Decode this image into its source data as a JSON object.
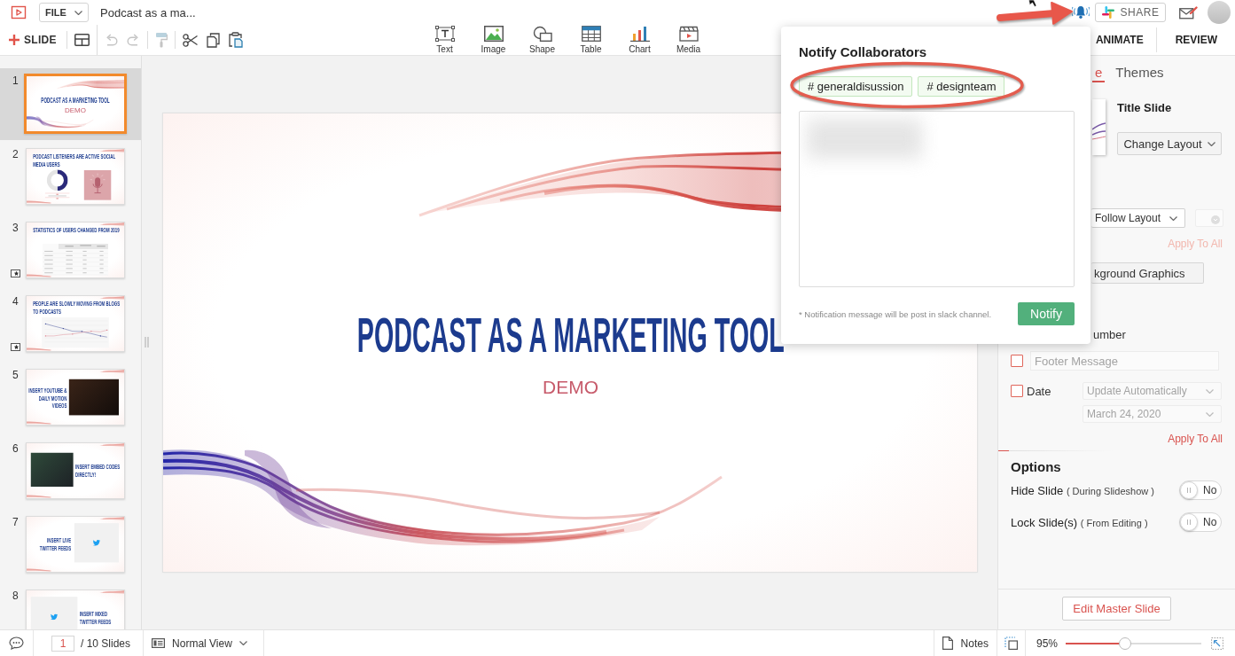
{
  "header": {
    "file_menu": "FILE",
    "document_title": "Podcast as a ma...",
    "share_button": "SHARE"
  },
  "toolbar": {
    "new_slide": "SLIDE",
    "edit_tools": [
      {
        "kind": "layout",
        "disabled": false
      },
      {
        "kind": "undo",
        "disabled": true
      },
      {
        "kind": "redo",
        "disabled": true
      },
      {
        "kind": "format_painter",
        "disabled": true
      },
      {
        "kind": "cut",
        "disabled": false
      },
      {
        "kind": "copy",
        "disabled": false
      },
      {
        "kind": "paste",
        "disabled": false
      }
    ],
    "insert_tools": [
      {
        "kind": "text",
        "label": "Text"
      },
      {
        "kind": "image",
        "label": "Image"
      },
      {
        "kind": "shape",
        "label": "Shape"
      },
      {
        "kind": "table",
        "label": "Table"
      },
      {
        "kind": "chart",
        "label": "Chart"
      },
      {
        "kind": "media",
        "label": "Media"
      }
    ],
    "menu_tabs": [
      {
        "label": "ANIMATE"
      },
      {
        "label": "REVIEW"
      }
    ]
  },
  "slides": [
    {
      "number": "1",
      "selected": true,
      "animated": false,
      "kind": "title",
      "title": "PODCAST AS A MARKETING TOOL",
      "subtitle": "DEMO"
    },
    {
      "number": "2",
      "selected": false,
      "animated": false,
      "kind": "donut_image",
      "title": "PODCAST LISTENERS ARE ACTIVE SOCIAL MEDIA USERS"
    },
    {
      "number": "3",
      "selected": false,
      "animated": true,
      "kind": "table",
      "title": "STATISTICS OF USERS CHANGED FROM 2019"
    },
    {
      "number": "4",
      "selected": false,
      "animated": true,
      "kind": "line_chart",
      "title": "PEOPLE ARE SLOWLY MOVING FROM BLOGS TO PODCASTS"
    },
    {
      "number": "5",
      "selected": false,
      "animated": false,
      "kind": "text_photo",
      "title": "INSERT YOUTUBE & DAILY MOTION VIDEOS"
    },
    {
      "number": "6",
      "selected": false,
      "animated": false,
      "kind": "photo_text",
      "title": "INSERT EMBED CODES DIRECTLY!"
    },
    {
      "number": "7",
      "selected": false,
      "animated": false,
      "kind": "text_tweet",
      "title": "INSERT LIVE TWITTER FEEDS"
    },
    {
      "number": "8",
      "selected": false,
      "animated": false,
      "kind": "tweet_text",
      "title": "INSERT MIXED TWITTER FEEDS"
    }
  ],
  "canvas": {
    "slide": {
      "kind": "title",
      "title": "PODCAST AS A MARKETING TOOL",
      "subtitle": "DEMO"
    }
  },
  "notify_popup": {
    "title": "Notify Collaborators",
    "channels": [
      "# generaldisussion",
      "# designteam"
    ],
    "note": "* Notification message will be post in slack channel.",
    "button": "Notify"
  },
  "right_panel": {
    "tabs": [
      {
        "label": "e",
        "selected": true
      },
      {
        "label": "Themes",
        "selected": false
      }
    ],
    "layout": {
      "name": "Title Slide",
      "button": "Change Layout"
    },
    "background": {
      "fill_select": "Follow Layout",
      "apply": {
        "label": "Apply To All",
        "disabled": true
      },
      "graphics_button": "kground Graphics"
    },
    "footer": {
      "slide_number_label": "umber",
      "message": {
        "checked": false,
        "placeholder": "Footer Message"
      },
      "date": {
        "checked": false,
        "label": "Date",
        "format": "Update Automatically",
        "value": "March 24, 2020"
      },
      "apply": {
        "label": "Apply To All",
        "disabled": false
      }
    },
    "options": {
      "title": "Options",
      "items": [
        {
          "label": "Hide Slide",
          "note": "( During Slideshow )",
          "on": false,
          "state_text": "No"
        },
        {
          "label": "Lock Slide(s)",
          "note": "( From Editing )",
          "on": false,
          "state_text": "No"
        }
      ]
    },
    "master_button": "Edit Master Slide"
  },
  "status_bar": {
    "page": "1",
    "page_total": "/ 10 Slides",
    "view": "Normal View",
    "notes": "Notes",
    "zoom": {
      "reading": "95%",
      "level": 0.44
    }
  }
}
